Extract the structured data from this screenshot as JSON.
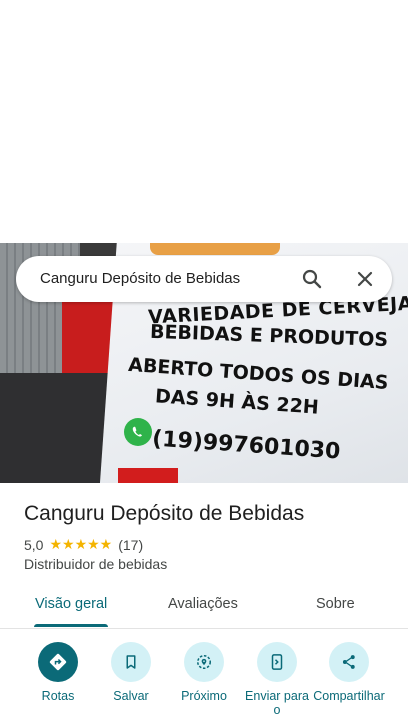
{
  "search": {
    "query": "Canguru Depósito de Bebidas"
  },
  "photo": {
    "sign_line_1": "VARIEDADE DE CERVEJAS,",
    "sign_line_2": "BEBIDAS E PRODUTOS",
    "sign_line_3": "ABERTO TODOS OS DIAS",
    "sign_line_4": "DAS 9H ÀS 22H",
    "sign_phone": "(19)997601030"
  },
  "place": {
    "title": "Canguru Depósito de Bebidas",
    "rating": "5,0",
    "stars": "★★★★★",
    "review_count": "(17)",
    "category": "Distribuidor de bebidas"
  },
  "tabs": [
    {
      "label": "Visão geral",
      "active": true
    },
    {
      "label": "Avaliações",
      "active": false
    },
    {
      "label": "Sobre",
      "active": false
    }
  ],
  "actions": [
    {
      "label": "Rotas",
      "icon": "directions-icon"
    },
    {
      "label": "Salvar",
      "icon": "bookmark-icon"
    },
    {
      "label": "Próximo",
      "icon": "nearby-icon"
    },
    {
      "label": "Enviar para o",
      "icon": "send-to-phone-icon"
    },
    {
      "label": "Compartilhar",
      "icon": "share-icon"
    }
  ],
  "colors": {
    "accent": "#0b6a78",
    "action_bg": "#d3f1f6",
    "star": "#f4b400"
  }
}
